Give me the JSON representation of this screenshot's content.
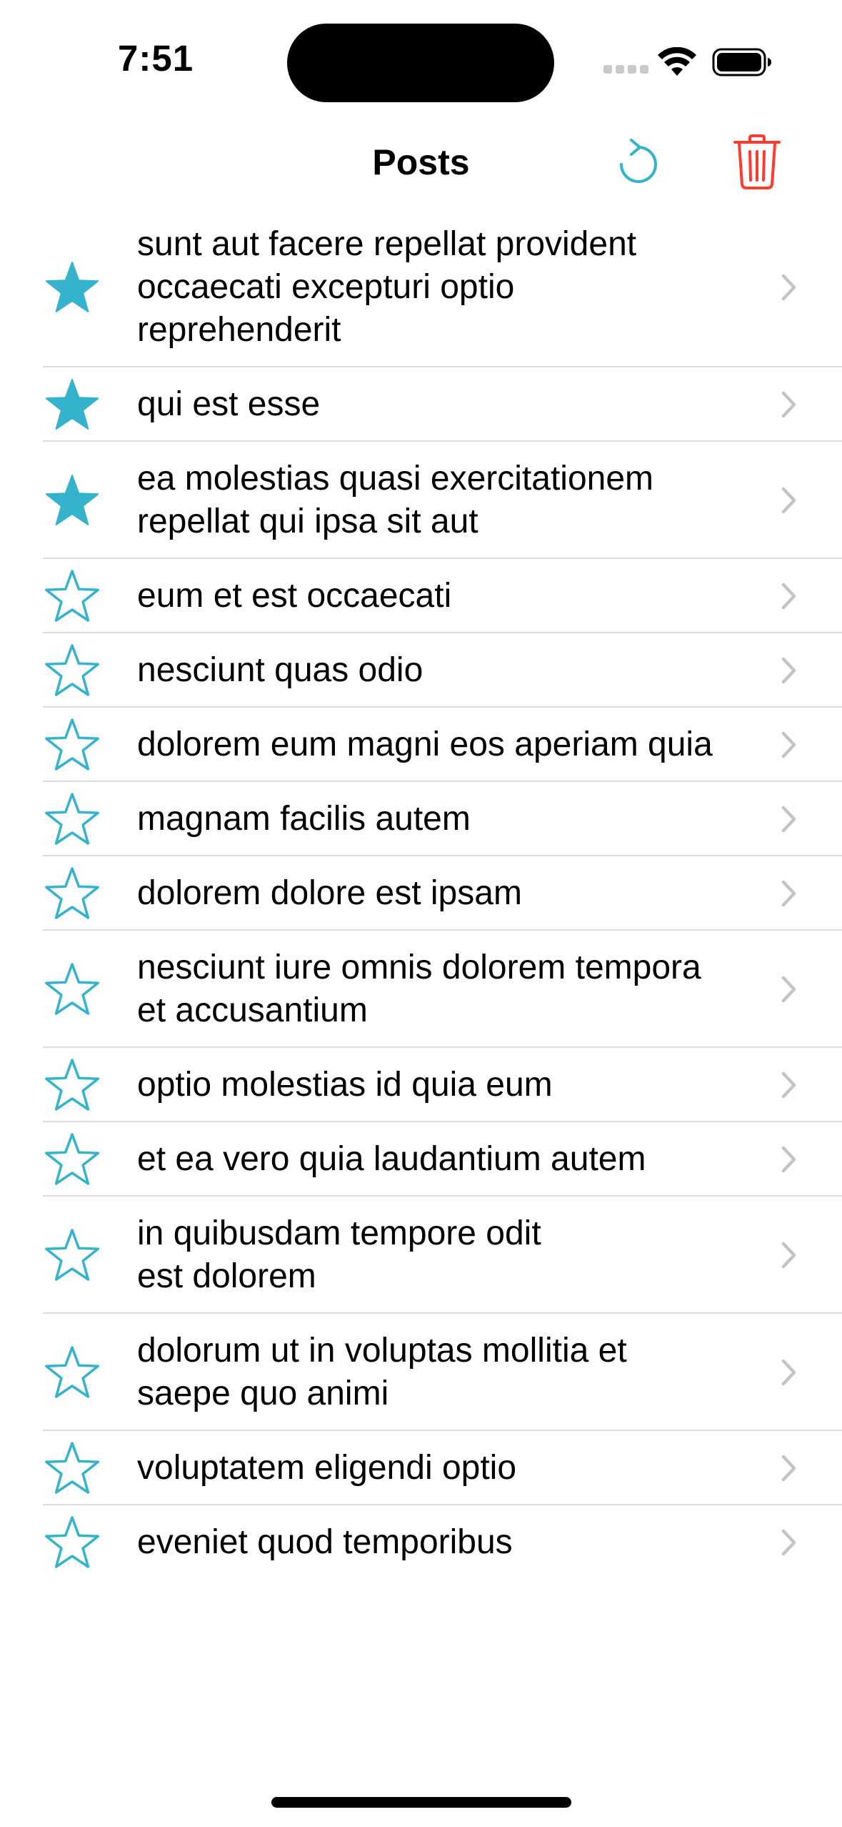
{
  "status_bar": {
    "time": "7:51"
  },
  "nav": {
    "title": "Posts",
    "refresh_icon": "refresh-icon",
    "trash_icon": "trash-icon"
  },
  "colors": {
    "accent": "#35b3cc",
    "destructive": "#ff3b30",
    "chevron": "#c4c4c7",
    "separator": "#dcdce0"
  },
  "posts": [
    {
      "title": "sunt aut facere repellat provident\noccaecati excepturi optio\nreprehenderit",
      "favorite": true
    },
    {
      "title": "qui est esse",
      "favorite": true
    },
    {
      "title": "ea molestias quasi exercitationem\nrepellat qui ipsa sit aut",
      "favorite": true
    },
    {
      "title": "eum et est occaecati",
      "favorite": false
    },
    {
      "title": "nesciunt quas odio",
      "favorite": false
    },
    {
      "title": "dolorem eum magni eos aperiam quia",
      "favorite": false
    },
    {
      "title": "magnam facilis autem",
      "favorite": false
    },
    {
      "title": "dolorem dolore est ipsam",
      "favorite": false
    },
    {
      "title": "nesciunt iure omnis dolorem tempora\net accusantium",
      "favorite": false
    },
    {
      "title": "optio molestias id quia eum",
      "favorite": false
    },
    {
      "title": "et ea vero quia laudantium autem",
      "favorite": false
    },
    {
      "title": "in quibusdam tempore odit\nest dolorem",
      "favorite": false
    },
    {
      "title": "dolorum ut in voluptas mollitia et\nsaepe quo animi",
      "favorite": false
    },
    {
      "title": "voluptatem eligendi optio",
      "favorite": false
    },
    {
      "title": "eveniet quod temporibus",
      "favorite": false
    }
  ]
}
